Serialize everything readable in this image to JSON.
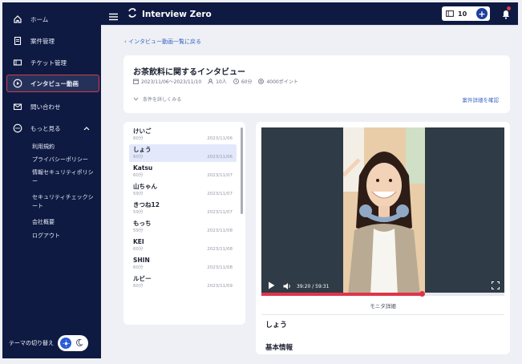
{
  "header": {
    "app_name": "Interview Zero",
    "ticket_count": "10",
    "ticket_add_label": "+"
  },
  "sidebar": {
    "items": [
      {
        "label": "ホーム",
        "icon": "home-icon"
      },
      {
        "label": "案件管理",
        "icon": "document-icon"
      },
      {
        "label": "チケット管理",
        "icon": "ticket-icon"
      },
      {
        "label": "インタビュー動画",
        "icon": "play-circle-icon",
        "active": true
      },
      {
        "label": "問い合わせ",
        "icon": "mail-icon"
      },
      {
        "label": "もっと見る",
        "icon": "more-icon"
      }
    ],
    "sub_items": [
      "利用規約",
      "プライバシーポリシー",
      "情報セキュリティポリシー",
      "セキュリティチェックシート",
      "会社概要",
      "ログアウト"
    ],
    "theme_label": "テーマの切り替え"
  },
  "main": {
    "back_link": "インタビュー動画一覧に戻る",
    "title": "お茶飲料に関するインタビュー",
    "period": "2023/11/06〜2023/11/10",
    "people": "10人",
    "duration": "60分",
    "points": "4000ポイント",
    "expand_label": "条件を詳しくみる",
    "detail_link": "案件詳細を確認"
  },
  "interviewees": [
    {
      "name": "けいご",
      "duration": "60分",
      "date": "2023/11/06"
    },
    {
      "name": "しょう",
      "duration": "60分",
      "date": "2023/11/06",
      "selected": true
    },
    {
      "name": "Katsu",
      "duration": "60分",
      "date": "2023/11/07"
    },
    {
      "name": "山ちゃん",
      "duration": "59分",
      "date": "2023/11/07"
    },
    {
      "name": "きつね12",
      "duration": "59分",
      "date": "2023/11/07"
    },
    {
      "name": "もっち",
      "duration": "59分",
      "date": "2023/11/08"
    },
    {
      "name": "KEI",
      "duration": "60分",
      "date": "2023/11/08"
    },
    {
      "name": "SHIN",
      "duration": "60分",
      "date": "2023/11/08"
    },
    {
      "name": "ルビー",
      "duration": "60分",
      "date": "2023/11/09"
    }
  ],
  "player": {
    "time": "39:20 / 59:31",
    "progress": 0.66
  },
  "monitor": {
    "tab_label": "モニタ詳細",
    "name": "しょう",
    "section_title": "基本情報"
  },
  "colors": {
    "sidebar_bg": "#0f1a43",
    "accent_red": "#e0344b",
    "link_blue": "#3a66c4"
  }
}
